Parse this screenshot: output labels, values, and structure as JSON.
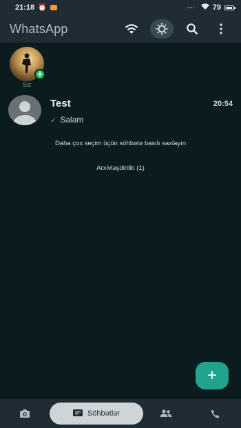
{
  "status_bar": {
    "time": "21:18",
    "battery": "79"
  },
  "app_bar": {
    "title": "WhatsApp",
    "icons": [
      "wifi-icon",
      "brightness-icon",
      "search-icon",
      "more-vert-icon"
    ]
  },
  "status": {
    "label": "Siz"
  },
  "chats": [
    {
      "name": "Test",
      "time": "20:54",
      "preview": "Salam",
      "preview_icon": "check-icon"
    }
  ],
  "hint": "Daha çox seçim üçün söhbətə basılı saxlayın",
  "archived": "Arxivləşdirilib (1)",
  "fab": {
    "icon": "plus-icon"
  },
  "bottom_nav": {
    "chats_label": "Söhbətlər",
    "icons": [
      "camera-icon",
      "chat-icon",
      "community-icon",
      "phone-icon"
    ]
  },
  "colors": {
    "background": "#0b1c1f",
    "bar": "#1f2c33",
    "accent": "#21a38e",
    "status_add": "#21c063"
  }
}
